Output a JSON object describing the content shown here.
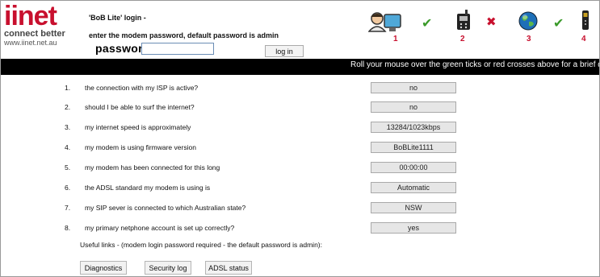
{
  "brand": {
    "logo": "iinet",
    "tagline": "connect better",
    "url": "www.iinet.net.au"
  },
  "login": {
    "title": "'BoB Lite' login -",
    "hint": "enter the modem password, default password is admin",
    "password_label": "password:",
    "password_value": "",
    "button_label": "log in"
  },
  "status": [
    {
      "number": "1",
      "icon": "user-computer-icon",
      "state": "ok",
      "state_icon": "tick-icon",
      "state_color": "#3a9a2a"
    },
    {
      "number": "2",
      "icon": "phone-icon",
      "state": "fail",
      "state_icon": "cross-icon",
      "state_color": "#c8102e"
    },
    {
      "number": "3",
      "icon": "globe-icon",
      "state": "ok",
      "state_icon": "tick-icon",
      "state_color": "#3a9a2a"
    },
    {
      "number": "4",
      "icon": "handset-icon",
      "state": "ok",
      "state_icon": "tick-icon",
      "state_color": "#3a9a2a"
    }
  ],
  "status_glyphs": {
    "ok": "✔",
    "fail": "✖"
  },
  "banner": "Roll your mouse over the green ticks or red crosses above for a brief descripti",
  "questions": [
    {
      "n": "1.",
      "text": "the connection with my ISP is active?",
      "value": "no"
    },
    {
      "n": "2.",
      "text": "should I be able to surf the internet?",
      "value": "no"
    },
    {
      "n": "3.",
      "text": "my internet speed is approximately",
      "value": "13284/1023kbps"
    },
    {
      "n": "4.",
      "text": "my modem is using firmware version",
      "value": "BoBLite1111"
    },
    {
      "n": "5.",
      "text": "my modem has been connected for this long",
      "value": "00:00:00"
    },
    {
      "n": "6.",
      "text": "the ADSL standard my modem is using is",
      "value": "Automatic"
    },
    {
      "n": "7.",
      "text": "my SIP sever is connected to which Australian state?",
      "value": "NSW"
    },
    {
      "n": "8.",
      "text": "my primary netphone account is set up correctly?",
      "value": "yes"
    }
  ],
  "links": {
    "caption": "Useful links - (modem login password required - the default password is admin):",
    "diagnostics": "Diagnostics",
    "security_log": "Security log",
    "adsl_status": "ADSL status"
  },
  "colors": {
    "brand_red": "#c8102e",
    "tick_green": "#3a9a2a",
    "bar_black": "#000000",
    "value_box": "#e6e6e6"
  }
}
